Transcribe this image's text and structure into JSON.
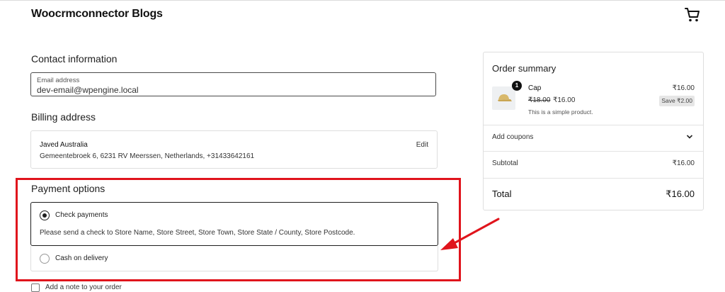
{
  "header": {
    "site_title": "Woocrmconnector Blogs",
    "cart_icon": "cart-icon"
  },
  "contact": {
    "heading": "Contact information",
    "email_label": "Email address",
    "email_value": "dev-email@wpengine.local"
  },
  "billing": {
    "heading": "Billing address",
    "name": "Javed Australia",
    "address": "Gemeentebroek 6, 6231 RV Meerssen, Netherlands, +31433642161",
    "edit_label": "Edit"
  },
  "payment": {
    "heading": "Payment options",
    "options": [
      {
        "label": "Check payments",
        "selected": true,
        "description": "Please send a check to Store Name, Store Street, Store Town, Store State / County, Store Postcode."
      },
      {
        "label": "Cash on delivery",
        "selected": false
      }
    ],
    "highlight_color": "#e0141c"
  },
  "note": {
    "label": "Add a note to your order"
  },
  "summary": {
    "title": "Order summary",
    "item": {
      "quantity": "1",
      "name": "Cap",
      "regular_price": "₹18.00",
      "sale_price": "₹16.00",
      "description": "This is a simple product.",
      "line_total": "₹16.00",
      "savings": "Save ₹2.00"
    },
    "coupons_label": "Add coupons",
    "subtotal_label": "Subtotal",
    "subtotal_value": "₹16.00",
    "total_label": "Total",
    "total_value": "₹16.00"
  }
}
